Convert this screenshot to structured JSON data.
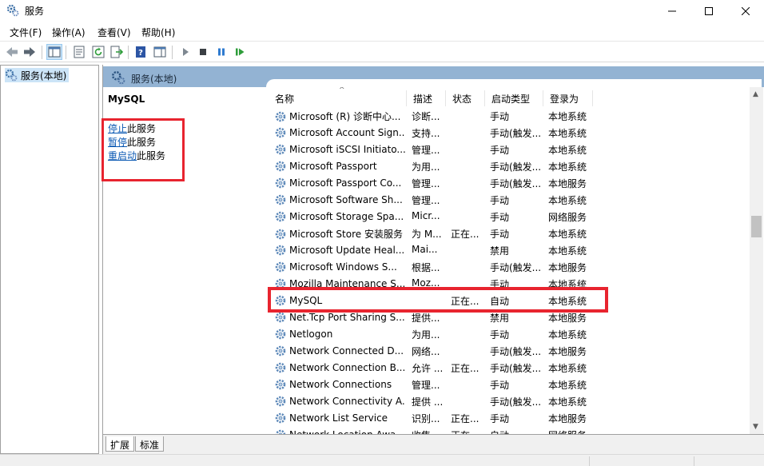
{
  "window": {
    "title": "服务",
    "minimize_icon": "minimize-icon",
    "maximize_icon": "maximize-icon",
    "close_icon": "close-icon"
  },
  "menubar": {
    "items": [
      {
        "label": "文件(F)"
      },
      {
        "label": "操作(A)"
      },
      {
        "label": "查看(V)"
      },
      {
        "label": "帮助(H)"
      }
    ]
  },
  "toolbar": {
    "buttons": [
      "back-arrow-icon",
      "forward-arrow-icon",
      "show-hide-console-tree-icon",
      "properties-icon",
      "refresh-icon",
      "export-list-icon",
      "help-icon",
      "action-pane-icon",
      "start-service-icon",
      "stop-service-icon",
      "pause-service-icon",
      "restart-service-icon"
    ]
  },
  "tree": {
    "items": [
      {
        "label": "服务(本地)"
      }
    ]
  },
  "main": {
    "header_title": "服务(本地)",
    "selected_service": "MySQL",
    "actions": [
      {
        "link": "停止",
        "suffix": "此服务"
      },
      {
        "link": "暂停",
        "suffix": "此服务"
      },
      {
        "link": "重启动",
        "suffix": "此服务"
      }
    ],
    "columns": [
      "名称",
      "描述",
      "状态",
      "启动类型",
      "登录为"
    ],
    "rows": [
      {
        "name": "Microsoft (R) 诊断中心...",
        "desc": "诊断...",
        "status": "",
        "start": "手动",
        "logon": "本地系统"
      },
      {
        "name": "Microsoft Account Sign...",
        "desc": "支持...",
        "status": "",
        "start": "手动(触发...",
        "logon": "本地系统"
      },
      {
        "name": "Microsoft iSCSI Initiato...",
        "desc": "管理...",
        "status": "",
        "start": "手动",
        "logon": "本地系统"
      },
      {
        "name": "Microsoft Passport",
        "desc": "为用...",
        "status": "",
        "start": "手动(触发...",
        "logon": "本地系统"
      },
      {
        "name": "Microsoft Passport Co...",
        "desc": "管理...",
        "status": "",
        "start": "手动(触发...",
        "logon": "本地服务"
      },
      {
        "name": "Microsoft Software Sh...",
        "desc": "管理...",
        "status": "",
        "start": "手动",
        "logon": "本地系统"
      },
      {
        "name": "Microsoft Storage Spa...",
        "desc": "Micr...",
        "status": "",
        "start": "手动",
        "logon": "网络服务"
      },
      {
        "name": "Microsoft Store 安装服务",
        "desc": "为 M...",
        "status": "正在...",
        "start": "手动",
        "logon": "本地系统"
      },
      {
        "name": "Microsoft Update Heal...",
        "desc": "Mai...",
        "status": "",
        "start": "禁用",
        "logon": "本地系统"
      },
      {
        "name": "Microsoft Windows S...",
        "desc": "根据...",
        "status": "",
        "start": "手动(触发...",
        "logon": "本地服务"
      },
      {
        "name": "Mozilla Maintenance S...",
        "desc": "Moz...",
        "status": "",
        "start": "手动",
        "logon": "本地系统"
      },
      {
        "name": "MySQL",
        "desc": "",
        "status": "正在...",
        "start": "自动",
        "logon": "本地系统"
      },
      {
        "name": "Net.Tcp Port Sharing S...",
        "desc": "提供...",
        "status": "",
        "start": "禁用",
        "logon": "本地服务"
      },
      {
        "name": "Netlogon",
        "desc": "为用...",
        "status": "",
        "start": "手动",
        "logon": "本地系统"
      },
      {
        "name": "Network Connected D...",
        "desc": "网络...",
        "status": "",
        "start": "手动(触发...",
        "logon": "本地服务"
      },
      {
        "name": "Network Connection B...",
        "desc": "允许 ...",
        "status": "正在...",
        "start": "手动(触发...",
        "logon": "本地系统"
      },
      {
        "name": "Network Connections",
        "desc": "管理...",
        "status": "",
        "start": "手动",
        "logon": "本地系统"
      },
      {
        "name": "Network Connectivity A...",
        "desc": "提供 ...",
        "status": "",
        "start": "手动(触发...",
        "logon": "本地系统"
      },
      {
        "name": "Network List Service",
        "desc": "识别...",
        "status": "正在...",
        "start": "手动",
        "logon": "本地服务"
      },
      {
        "name": "Network Location Awa...",
        "desc": "收集...",
        "status": "正在...",
        "start": "自动",
        "logon": "网络服务"
      }
    ]
  },
  "tabs": [
    {
      "label": "扩展"
    },
    {
      "label": "标准"
    }
  ],
  "colors": {
    "header_band": "#93b3d3",
    "highlight_box": "#e8242f",
    "link": "#0b59b3",
    "tree_selection": "#cce4f7"
  }
}
